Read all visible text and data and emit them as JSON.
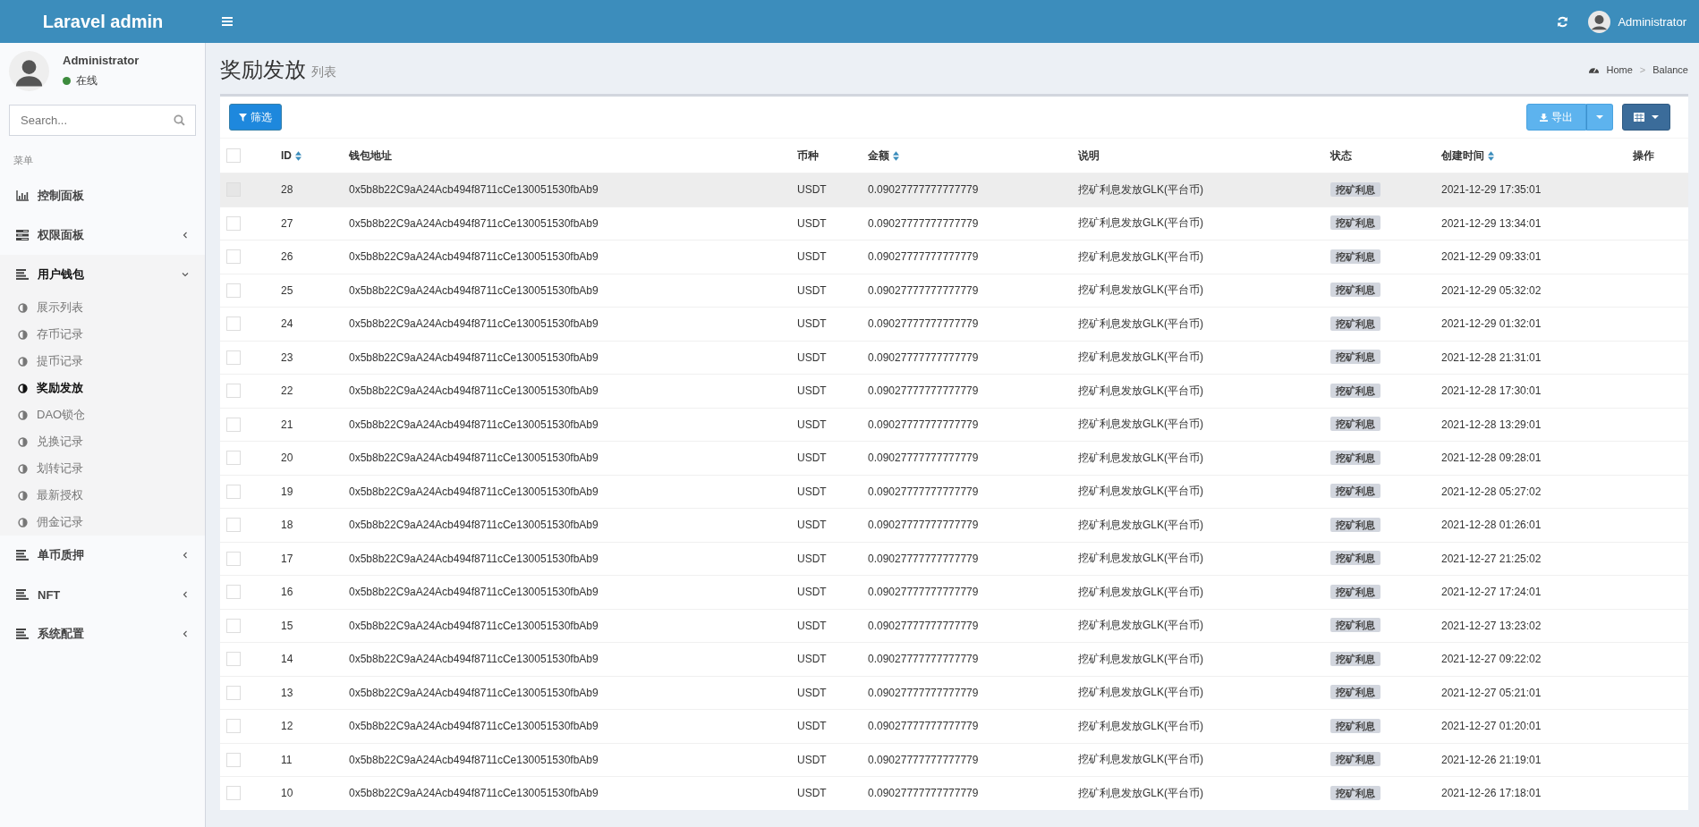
{
  "header": {
    "logo": "Laravel admin",
    "user": "Administrator"
  },
  "sidebar": {
    "user": {
      "name": "Administrator",
      "status": "在线"
    },
    "search": {
      "placeholder": "Search..."
    },
    "menu_label": "菜单",
    "items": [
      {
        "label": "控制面板",
        "kind": "chart"
      },
      {
        "label": "权限面板",
        "kind": "tasks",
        "expanded": false
      },
      {
        "label": "用户钱包",
        "kind": "bars",
        "expanded": true,
        "children": [
          {
            "label": "展示列表",
            "selected": false
          },
          {
            "label": "存币记录",
            "selected": false
          },
          {
            "label": "提币记录",
            "selected": false
          },
          {
            "label": "奖励发放",
            "selected": true
          },
          {
            "label": "DAO锁仓",
            "selected": false
          },
          {
            "label": "兑换记录",
            "selected": false
          },
          {
            "label": "划转记录",
            "selected": false
          },
          {
            "label": "最新授权",
            "selected": false
          },
          {
            "label": "佣金记录",
            "selected": false
          }
        ]
      },
      {
        "label": "单币质押",
        "kind": "bars",
        "expanded": false
      },
      {
        "label": "NFT",
        "kind": "bars",
        "expanded": false
      },
      {
        "label": "系统配置",
        "kind": "bars",
        "expanded": false
      }
    ]
  },
  "page": {
    "title": "奖励发放",
    "subtitle": "列表",
    "breadcrumb": [
      "Home",
      "Balance"
    ],
    "breadcrumb_separator": ">"
  },
  "toolbar": {
    "filter": "筛选",
    "export": "导出"
  },
  "table": {
    "all_checked": false,
    "columns": [
      {
        "label": "ID",
        "sortable": true
      },
      {
        "label": "钱包地址",
        "sortable": false
      },
      {
        "label": "币种",
        "sortable": false
      },
      {
        "label": "金额",
        "sortable": true
      },
      {
        "label": "说明",
        "sortable": false
      },
      {
        "label": "状态",
        "sortable": false
      },
      {
        "label": "创建时间",
        "sortable": true
      },
      {
        "label": "操作",
        "sortable": false
      }
    ],
    "rows": [
      {
        "id": "28",
        "address": "0x5b8b22C9aA24Acb494f8711cCe130051530fbAb9",
        "coin": "USDT",
        "amount": "0.09027777777777779",
        "note": "挖矿利息发放GLK(平台币)",
        "status": "挖矿利息",
        "time": "2021-12-29 17:35:01",
        "hovered": true
      },
      {
        "id": "27",
        "address": "0x5b8b22C9aA24Acb494f8711cCe130051530fbAb9",
        "coin": "USDT",
        "amount": "0.09027777777777779",
        "note": "挖矿利息发放GLK(平台币)",
        "status": "挖矿利息",
        "time": "2021-12-29 13:34:01",
        "hovered": false
      },
      {
        "id": "26",
        "address": "0x5b8b22C9aA24Acb494f8711cCe130051530fbAb9",
        "coin": "USDT",
        "amount": "0.09027777777777779",
        "note": "挖矿利息发放GLK(平台币)",
        "status": "挖矿利息",
        "time": "2021-12-29 09:33:01",
        "hovered": false
      },
      {
        "id": "25",
        "address": "0x5b8b22C9aA24Acb494f8711cCe130051530fbAb9",
        "coin": "USDT",
        "amount": "0.09027777777777779",
        "note": "挖矿利息发放GLK(平台币)",
        "status": "挖矿利息",
        "time": "2021-12-29 05:32:02",
        "hovered": false
      },
      {
        "id": "24",
        "address": "0x5b8b22C9aA24Acb494f8711cCe130051530fbAb9",
        "coin": "USDT",
        "amount": "0.09027777777777779",
        "note": "挖矿利息发放GLK(平台币)",
        "status": "挖矿利息",
        "time": "2021-12-29 01:32:01",
        "hovered": false
      },
      {
        "id": "23",
        "address": "0x5b8b22C9aA24Acb494f8711cCe130051530fbAb9",
        "coin": "USDT",
        "amount": "0.09027777777777779",
        "note": "挖矿利息发放GLK(平台币)",
        "status": "挖矿利息",
        "time": "2021-12-28 21:31:01",
        "hovered": false
      },
      {
        "id": "22",
        "address": "0x5b8b22C9aA24Acb494f8711cCe130051530fbAb9",
        "coin": "USDT",
        "amount": "0.09027777777777779",
        "note": "挖矿利息发放GLK(平台币)",
        "status": "挖矿利息",
        "time": "2021-12-28 17:30:01",
        "hovered": false
      },
      {
        "id": "21",
        "address": "0x5b8b22C9aA24Acb494f8711cCe130051530fbAb9",
        "coin": "USDT",
        "amount": "0.09027777777777779",
        "note": "挖矿利息发放GLK(平台币)",
        "status": "挖矿利息",
        "time": "2021-12-28 13:29:01",
        "hovered": false
      },
      {
        "id": "20",
        "address": "0x5b8b22C9aA24Acb494f8711cCe130051530fbAb9",
        "coin": "USDT",
        "amount": "0.09027777777777779",
        "note": "挖矿利息发放GLK(平台币)",
        "status": "挖矿利息",
        "time": "2021-12-28 09:28:01",
        "hovered": false
      },
      {
        "id": "19",
        "address": "0x5b8b22C9aA24Acb494f8711cCe130051530fbAb9",
        "coin": "USDT",
        "amount": "0.09027777777777779",
        "note": "挖矿利息发放GLK(平台币)",
        "status": "挖矿利息",
        "time": "2021-12-28 05:27:02",
        "hovered": false
      },
      {
        "id": "18",
        "address": "0x5b8b22C9aA24Acb494f8711cCe130051530fbAb9",
        "coin": "USDT",
        "amount": "0.09027777777777779",
        "note": "挖矿利息发放GLK(平台币)",
        "status": "挖矿利息",
        "time": "2021-12-28 01:26:01",
        "hovered": false
      },
      {
        "id": "17",
        "address": "0x5b8b22C9aA24Acb494f8711cCe130051530fbAb9",
        "coin": "USDT",
        "amount": "0.09027777777777779",
        "note": "挖矿利息发放GLK(平台币)",
        "status": "挖矿利息",
        "time": "2021-12-27 21:25:02",
        "hovered": false
      },
      {
        "id": "16",
        "address": "0x5b8b22C9aA24Acb494f8711cCe130051530fbAb9",
        "coin": "USDT",
        "amount": "0.09027777777777779",
        "note": "挖矿利息发放GLK(平台币)",
        "status": "挖矿利息",
        "time": "2021-12-27 17:24:01",
        "hovered": false
      },
      {
        "id": "15",
        "address": "0x5b8b22C9aA24Acb494f8711cCe130051530fbAb9",
        "coin": "USDT",
        "amount": "0.09027777777777779",
        "note": "挖矿利息发放GLK(平台币)",
        "status": "挖矿利息",
        "time": "2021-12-27 13:23:02",
        "hovered": false
      },
      {
        "id": "14",
        "address": "0x5b8b22C9aA24Acb494f8711cCe130051530fbAb9",
        "coin": "USDT",
        "amount": "0.09027777777777779",
        "note": "挖矿利息发放GLK(平台币)",
        "status": "挖矿利息",
        "time": "2021-12-27 09:22:02",
        "hovered": false
      },
      {
        "id": "13",
        "address": "0x5b8b22C9aA24Acb494f8711cCe130051530fbAb9",
        "coin": "USDT",
        "amount": "0.09027777777777779",
        "note": "挖矿利息发放GLK(平台币)",
        "status": "挖矿利息",
        "time": "2021-12-27 05:21:01",
        "hovered": false
      },
      {
        "id": "12",
        "address": "0x5b8b22C9aA24Acb494f8711cCe130051530fbAb9",
        "coin": "USDT",
        "amount": "0.09027777777777779",
        "note": "挖矿利息发放GLK(平台币)",
        "status": "挖矿利息",
        "time": "2021-12-27 01:20:01",
        "hovered": false
      },
      {
        "id": "11",
        "address": "0x5b8b22C9aA24Acb494f8711cCe130051530fbAb9",
        "coin": "USDT",
        "amount": "0.09027777777777779",
        "note": "挖矿利息发放GLK(平台币)",
        "status": "挖矿利息",
        "time": "2021-12-26 21:19:01",
        "hovered": false
      },
      {
        "id": "10",
        "address": "0x5b8b22C9aA24Acb494f8711cCe130051530fbAb9",
        "coin": "USDT",
        "amount": "0.09027777777777779",
        "note": "挖矿利息发放GLK(平台币)",
        "status": "挖矿利息",
        "time": "2021-12-26 17:18:01",
        "hovered": false
      }
    ]
  }
}
